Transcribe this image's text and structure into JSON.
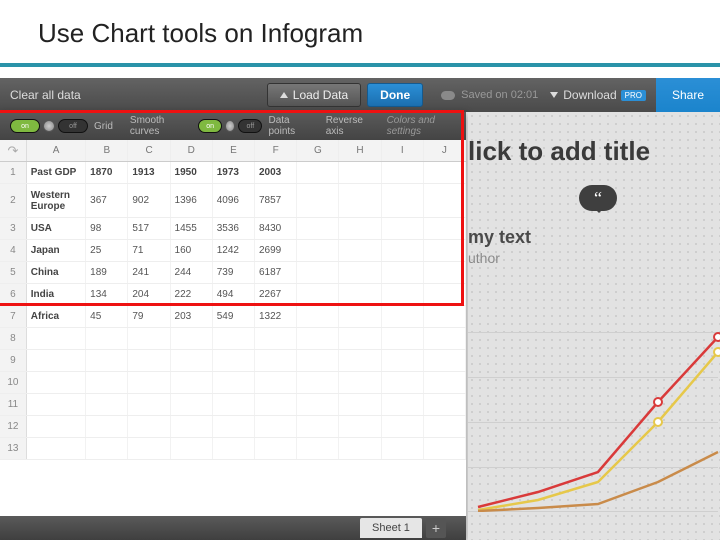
{
  "slide": {
    "title": "Use Chart tools on Infogram"
  },
  "topbar": {
    "clear": "Clear all data",
    "load": "Load Data",
    "done": "Done",
    "saved": "Saved on 02:01",
    "download": "Download",
    "pro": "PRO",
    "share": "Share"
  },
  "toggles": {
    "on": "on",
    "off": "off",
    "grid": "Grid",
    "smooth": "Smooth curves",
    "datapoints": "Data points",
    "reverse": "Reverse axis",
    "colors": "Colors and settings"
  },
  "columns": [
    "A",
    "B",
    "C",
    "D",
    "E",
    "F",
    "G",
    "H",
    "I",
    "J"
  ],
  "rows": [
    "1",
    "2",
    "3",
    "4",
    "5",
    "6",
    "7",
    "8",
    "9",
    "10",
    "11",
    "12",
    "13"
  ],
  "redo": "↷",
  "chart_data": {
    "type": "line",
    "title": "Past GDP",
    "categories": [
      "1870",
      "1913",
      "1950",
      "1973",
      "2003"
    ],
    "series": [
      {
        "name": "Western Europe",
        "values": [
          367,
          902,
          1396,
          4096,
          7857
        ]
      },
      {
        "name": "USA",
        "values": [
          98,
          517,
          1455,
          3536,
          8430
        ]
      },
      {
        "name": "Japan",
        "values": [
          25,
          71,
          160,
          1242,
          2699
        ]
      },
      {
        "name": "China",
        "values": [
          189,
          241,
          244,
          739,
          6187
        ]
      },
      {
        "name": "India",
        "values": [
          134,
          204,
          222,
          494,
          2267
        ]
      },
      {
        "name": "Africa",
        "values": [
          45,
          79,
          203,
          549,
          1322
        ]
      }
    ],
    "xlabel": "",
    "ylabel": "",
    "ylim": [
      0,
      9000
    ]
  },
  "tabs": {
    "sheet1": "Sheet 1",
    "add": "+"
  },
  "preview": {
    "title_placeholder": "lick to add title",
    "quote_glyph": "“",
    "body": "my text",
    "author": "uthor"
  }
}
